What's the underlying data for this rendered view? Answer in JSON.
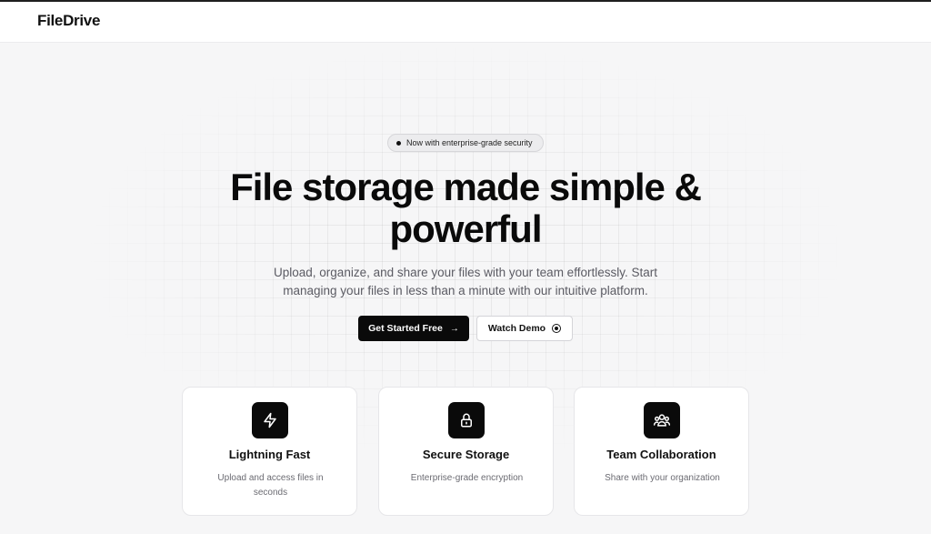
{
  "header": {
    "logo": "FileDrive"
  },
  "hero": {
    "badge": "Now with enterprise-grade security",
    "headline": "File storage made simple & powerful",
    "subtitle": "Upload, organize, and share your files with your team effortlessly. Start managing your files in less than a minute with our intuitive platform.",
    "primary_cta": "Get Started Free",
    "secondary_cta": "Watch Demo"
  },
  "features": [
    {
      "title": "Lightning Fast",
      "description": "Upload and access files in seconds",
      "icon": "lightning-icon"
    },
    {
      "title": "Secure Storage",
      "description": "Enterprise-grade encryption",
      "icon": "lock-icon"
    },
    {
      "title": "Team Collaboration",
      "description": "Share with your organization",
      "icon": "users-icon"
    }
  ],
  "colors": {
    "primary": "#0a0a0a",
    "background": "#f6f6f7",
    "muted_text": "#5b5b63"
  }
}
